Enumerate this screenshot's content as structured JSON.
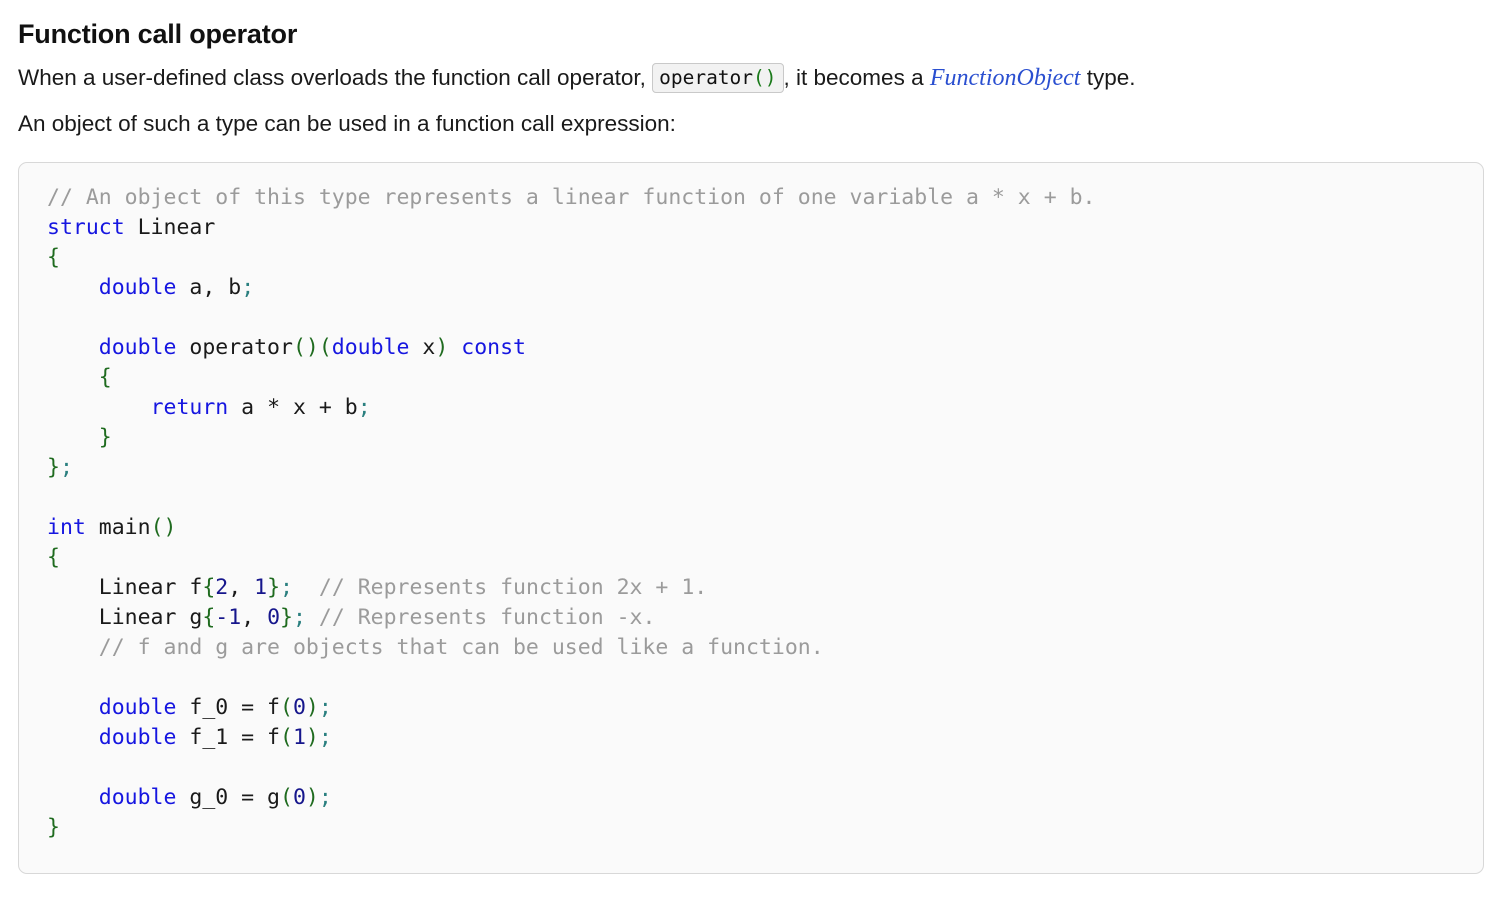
{
  "page": {
    "title": "Function call operator",
    "paragraph1": {
      "before_code": "When a user-defined class overloads the function call operator, ",
      "inline_code_name": "operator",
      "inline_code_parens": "()",
      "after_code": ", it becomes a ",
      "link_text": "FunctionObject",
      "after_link": " type."
    },
    "paragraph2": "An object of such a type can be used in a function call expression:"
  },
  "code_block": {
    "language": "cpp",
    "lines": [
      {
        "tokens": [
          {
            "t": "// An object of this type represents a linear function of one variable a * x + b.",
            "c": "cmt"
          }
        ]
      },
      {
        "tokens": [
          {
            "t": "struct",
            "c": "kw"
          },
          {
            "t": " Linear",
            "c": "id"
          }
        ]
      },
      {
        "tokens": [
          {
            "t": "{",
            "c": "brc"
          }
        ]
      },
      {
        "tokens": [
          {
            "t": "    ",
            "c": "id"
          },
          {
            "t": "double",
            "c": "kw"
          },
          {
            "t": " a, b",
            "c": "id"
          },
          {
            "t": ";",
            "c": "semi"
          }
        ]
      },
      {
        "tokens": []
      },
      {
        "tokens": [
          {
            "t": "    ",
            "c": "id"
          },
          {
            "t": "double",
            "c": "kw"
          },
          {
            "t": " operator",
            "c": "id"
          },
          {
            "t": "()(",
            "c": "punc"
          },
          {
            "t": "double",
            "c": "kw"
          },
          {
            "t": " x",
            "c": "id"
          },
          {
            "t": ")",
            "c": "punc"
          },
          {
            "t": " ",
            "c": "id"
          },
          {
            "t": "const",
            "c": "kw"
          }
        ]
      },
      {
        "tokens": [
          {
            "t": "    ",
            "c": "id"
          },
          {
            "t": "{",
            "c": "brc"
          }
        ]
      },
      {
        "tokens": [
          {
            "t": "        ",
            "c": "id"
          },
          {
            "t": "return",
            "c": "kw"
          },
          {
            "t": " a * x + b",
            "c": "id"
          },
          {
            "t": ";",
            "c": "semi"
          }
        ]
      },
      {
        "tokens": [
          {
            "t": "    ",
            "c": "id"
          },
          {
            "t": "}",
            "c": "brc"
          }
        ]
      },
      {
        "tokens": [
          {
            "t": "}",
            "c": "brc"
          },
          {
            "t": ";",
            "c": "semi"
          }
        ]
      },
      {
        "tokens": []
      },
      {
        "tokens": [
          {
            "t": "int",
            "c": "kw"
          },
          {
            "t": " main",
            "c": "id"
          },
          {
            "t": "()",
            "c": "punc"
          }
        ]
      },
      {
        "tokens": [
          {
            "t": "{",
            "c": "brc"
          }
        ]
      },
      {
        "tokens": [
          {
            "t": "    Linear f",
            "c": "id"
          },
          {
            "t": "{",
            "c": "brc"
          },
          {
            "t": "2",
            "c": "num"
          },
          {
            "t": ", ",
            "c": "id"
          },
          {
            "t": "1",
            "c": "num"
          },
          {
            "t": "}",
            "c": "brc"
          },
          {
            "t": ";",
            "c": "semi"
          },
          {
            "t": "  ",
            "c": "id"
          },
          {
            "t": "// Represents function 2x + 1.",
            "c": "cmt"
          }
        ]
      },
      {
        "tokens": [
          {
            "t": "    Linear g",
            "c": "id"
          },
          {
            "t": "{",
            "c": "brc"
          },
          {
            "t": "-1",
            "c": "num"
          },
          {
            "t": ", ",
            "c": "id"
          },
          {
            "t": "0",
            "c": "num"
          },
          {
            "t": "}",
            "c": "brc"
          },
          {
            "t": ";",
            "c": "semi"
          },
          {
            "t": " ",
            "c": "id"
          },
          {
            "t": "// Represents function -x.",
            "c": "cmt"
          }
        ]
      },
      {
        "tokens": [
          {
            "t": "    ",
            "c": "id"
          },
          {
            "t": "// f and g are objects that can be used like a function.",
            "c": "cmt"
          }
        ]
      },
      {
        "tokens": []
      },
      {
        "tokens": [
          {
            "t": "    ",
            "c": "id"
          },
          {
            "t": "double",
            "c": "kw"
          },
          {
            "t": " f_0 = f",
            "c": "id"
          },
          {
            "t": "(",
            "c": "punc"
          },
          {
            "t": "0",
            "c": "num"
          },
          {
            "t": ")",
            "c": "punc"
          },
          {
            "t": ";",
            "c": "semi"
          }
        ]
      },
      {
        "tokens": [
          {
            "t": "    ",
            "c": "id"
          },
          {
            "t": "double",
            "c": "kw"
          },
          {
            "t": " f_1 = f",
            "c": "id"
          },
          {
            "t": "(",
            "c": "punc"
          },
          {
            "t": "1",
            "c": "num"
          },
          {
            "t": ")",
            "c": "punc"
          },
          {
            "t": ";",
            "c": "semi"
          }
        ]
      },
      {
        "tokens": []
      },
      {
        "tokens": [
          {
            "t": "    ",
            "c": "id"
          },
          {
            "t": "double",
            "c": "kw"
          },
          {
            "t": " g_0 = g",
            "c": "id"
          },
          {
            "t": "(",
            "c": "punc"
          },
          {
            "t": "0",
            "c": "num"
          },
          {
            "t": ")",
            "c": "punc"
          },
          {
            "t": ";",
            "c": "semi"
          }
        ]
      },
      {
        "tokens": [
          {
            "t": "}",
            "c": "brc"
          }
        ]
      }
    ]
  },
  "colors": {
    "keyword": "#1616e0",
    "number": "#16168c",
    "brace": "#1f6b1f",
    "paren": "#1f6b1f",
    "semicolon": "#2a7f7f",
    "comment": "#9b9b9b",
    "link": "#2a4fd0",
    "code_bg": "#fafafa",
    "code_border": "#d8d8d8",
    "inline_code_bg": "#f2f2f2"
  }
}
